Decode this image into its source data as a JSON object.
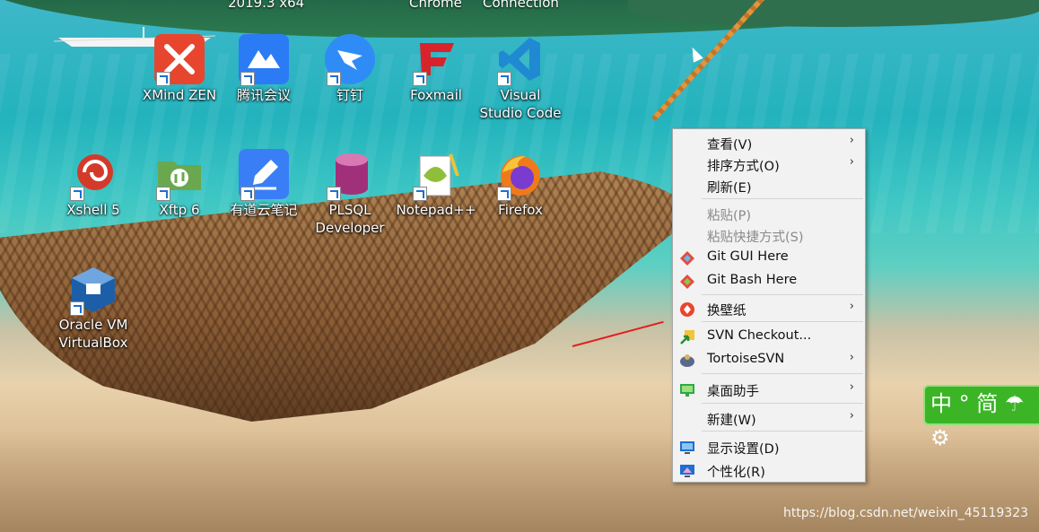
{
  "desktop": {
    "top_partial_labels": [
      "2019.3 x64",
      "Chrome",
      "Connection"
    ],
    "icons": [
      {
        "label": "XMind ZEN",
        "icon": "xmind-icon",
        "color": "#e8452e"
      },
      {
        "label": "腾讯会议",
        "icon": "tencent-meeting-icon",
        "color": "#2b7bf5"
      },
      {
        "label": "钉钉",
        "icon": "dingtalk-icon",
        "color": "#2f8cf7"
      },
      {
        "label": "Foxmail",
        "icon": "foxmail-icon",
        "color": "#d8232a"
      },
      {
        "label": "Visual\nStudio Code",
        "icon": "vscode-icon",
        "color": "#1f8ad2"
      },
      {
        "label": "Xshell 5",
        "icon": "xshell-icon",
        "color": "#d43a2a"
      },
      {
        "label": "Xftp 6",
        "icon": "xftp-icon",
        "color": "#6aa84f"
      },
      {
        "label": "有道云笔记",
        "icon": "youdao-note-icon",
        "color": "#3a7ef5"
      },
      {
        "label": "PLSQL\nDeveloper",
        "icon": "plsql-icon",
        "color": "#a0307a"
      },
      {
        "label": "Notepad++",
        "icon": "notepadpp-icon",
        "color": "#8fbf3a"
      },
      {
        "label": "Firefox",
        "icon": "firefox-icon",
        "color": "#f07a1a"
      },
      {
        "label": "Oracle VM\nVirtualBox",
        "icon": "virtualbox-icon",
        "color": "#1c5fa8"
      }
    ]
  },
  "context_menu": {
    "items": [
      {
        "label": "查看(V)",
        "submenu": true,
        "disabled": false,
        "icon": ""
      },
      {
        "label": "排序方式(O)",
        "submenu": true,
        "disabled": false,
        "icon": ""
      },
      {
        "label": "刷新(E)",
        "submenu": false,
        "disabled": false,
        "icon": ""
      },
      {
        "label": "粘贴(P)",
        "submenu": false,
        "disabled": true,
        "icon": ""
      },
      {
        "label": "粘贴快捷方式(S)",
        "submenu": false,
        "disabled": true,
        "icon": ""
      },
      {
        "label": "Git GUI Here",
        "submenu": false,
        "disabled": false,
        "icon": "git-gui-icon"
      },
      {
        "label": "Git Bash Here",
        "submenu": false,
        "disabled": false,
        "icon": "git-bash-icon"
      },
      {
        "label": "换壁纸",
        "submenu": true,
        "disabled": false,
        "icon": "wallpaper-icon"
      },
      {
        "label": "SVN Checkout...",
        "submenu": false,
        "disabled": false,
        "icon": "svn-checkout-icon"
      },
      {
        "label": "TortoiseSVN",
        "submenu": true,
        "disabled": false,
        "icon": "tortoisesvn-icon"
      },
      {
        "label": "桌面助手",
        "submenu": true,
        "disabled": false,
        "icon": "desktop-assistant-icon"
      },
      {
        "label": "新建(W)",
        "submenu": true,
        "disabled": false,
        "icon": ""
      },
      {
        "label": "显示设置(D)",
        "submenu": false,
        "disabled": false,
        "icon": "display-settings-icon"
      },
      {
        "label": "个性化(R)",
        "submenu": false,
        "disabled": false,
        "icon": "personalize-icon"
      }
    ],
    "arrow_glyph": "›"
  },
  "ime_bar": {
    "text": "中 ° 简 ☂ ☽ ⚙"
  },
  "watermark": "https://blog.csdn.net/weixin_45119323"
}
